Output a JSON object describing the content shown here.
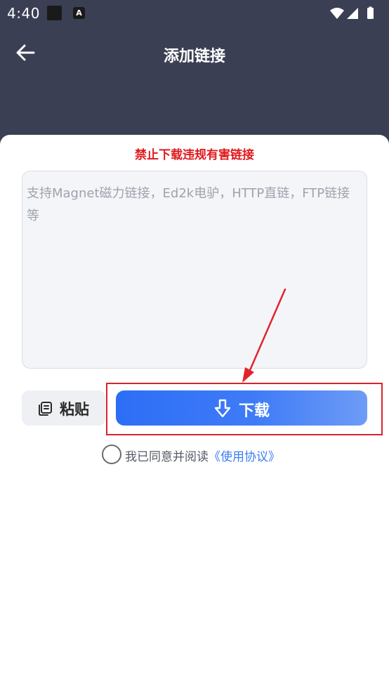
{
  "status_bar": {
    "time": "4:40",
    "badge_letter": "A"
  },
  "header": {
    "title": "添加链接"
  },
  "warning": {
    "text": "禁止下载违规有害链接"
  },
  "link_input": {
    "value": "",
    "placeholder": "支持Magnet磁力链接，Ed2k电驴，HTTP直链，FTP链接等"
  },
  "buttons": {
    "paste_label": "粘贴",
    "download_label": "下载"
  },
  "agreement": {
    "checked": false,
    "prefix": "我已同意并阅读",
    "link_text": "《使用协议》"
  },
  "colors": {
    "app_bar_bg": "#3b3f54",
    "warning": "#e0191e",
    "accent": "#2c6ef6",
    "link": "#3c7cf2",
    "annotation": "#d8222f"
  },
  "icons": {
    "back": "arrow-left-icon",
    "paste": "clipboard-icon",
    "download": "arrow-down-icon",
    "wifi": "wifi-icon",
    "signal": "signal-icon",
    "battery": "battery-icon"
  }
}
